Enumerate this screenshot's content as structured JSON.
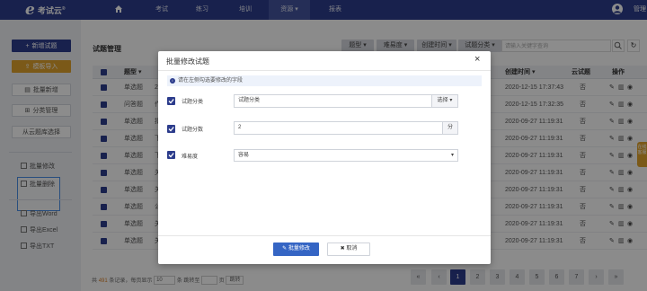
{
  "nav": {
    "logo_text": "考试云",
    "logo_mark": "®",
    "items": [
      "考试",
      "练习",
      "培训",
      "资源",
      "报表"
    ],
    "active_caret": "▾",
    "user": "管理"
  },
  "sidebar": {
    "new_question": "新增试题",
    "template_import": "模板导入",
    "bulk_add": "批量新增",
    "category_manage": "分类管理",
    "cloud_select": "从云题库选择",
    "bulk_edit": "批量修改",
    "bulk_delete": "批量删除",
    "export_word": "导出Word",
    "export_excel": "导出Excel",
    "export_txt": "导出TXT"
  },
  "main": {
    "title": "试题管理",
    "filters": [
      "题型",
      "难易度",
      "创建时间",
      "试题分类"
    ],
    "search_placeholder": "请输入关键字查询",
    "columns": {
      "type": "题型",
      "created": "创建时间",
      "cloud": "云试题",
      "ops": "操作"
    },
    "rows": [
      {
        "type": "单选题",
        "prefix": "2",
        "created": "2020-12-15 17:37:43",
        "cloud": "否"
      },
      {
        "type": "问答题",
        "prefix": "作",
        "created": "2020-12-15 17:32:35",
        "cloud": "否"
      },
      {
        "type": "单选题",
        "prefix": "扣",
        "created": "2020-09-27 11:19:31",
        "cloud": "否"
      },
      {
        "type": "单选题",
        "prefix": "下",
        "created": "2020-09-27 11:19:31",
        "cloud": "否"
      },
      {
        "type": "单选题",
        "prefix": "下",
        "created": "2020-09-27 11:19:31",
        "cloud": "否"
      },
      {
        "type": "单选题",
        "prefix": "关",
        "created": "2020-09-27 11:19:31",
        "cloud": "否"
      },
      {
        "type": "单选题",
        "prefix": "关",
        "created": "2020-09-27 11:19:31",
        "cloud": "否"
      },
      {
        "type": "单选题",
        "prefix": "公",
        "created": "2020-09-27 11:19:31",
        "cloud": "否"
      },
      {
        "type": "单选题",
        "prefix": "关",
        "created": "2020-09-27 11:19:31",
        "cloud": "否"
      },
      {
        "type": "单选题",
        "prefix": "关",
        "created": "2020-09-27 11:19:31",
        "cloud": "否"
      }
    ],
    "side_tab": "在线客服"
  },
  "footer": {
    "total_pre": "共",
    "total_count": "491",
    "total_post": "条记录，每页显示",
    "per_page": "10",
    "per_page_post": "条",
    "jump_label": "跳转至",
    "page_post": "页",
    "go": "跳转",
    "pages": [
      "«",
      "‹",
      "1",
      "2",
      "3",
      "4",
      "5",
      "6",
      "7",
      "›",
      "»"
    ]
  },
  "modal": {
    "title": "批量修改试题",
    "close": "×",
    "tip": "请在左侧勾选要修改的字段",
    "fields": {
      "category_label": "试题分类",
      "category_value": "试题分类",
      "category_addon": "选择",
      "score_label": "试题分数",
      "score_value": "2",
      "score_addon": "分",
      "difficulty_label": "难易度",
      "difficulty_value": "容易"
    },
    "ok": "批量修改",
    "cancel": "取消"
  },
  "colors": {
    "nav": "#2c3c8c",
    "primary": "#3565c4",
    "orange": "#e0a22d",
    "highlight_border": "#4a8ee6"
  }
}
